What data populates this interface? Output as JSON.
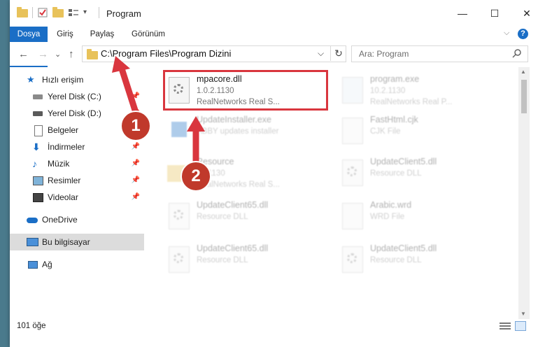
{
  "window": {
    "title": "Program",
    "controls": {
      "minimize": "—",
      "maximize": "☐",
      "close": "✕"
    }
  },
  "ribbon": {
    "tabs": [
      "Dosya",
      "Giriş",
      "Paylaş",
      "Görünüm"
    ],
    "expand_icon": "chevron-down-icon",
    "help_label": "?"
  },
  "navigation": {
    "back": "←",
    "forward": "→",
    "dropdown": "⌄",
    "up": "↑",
    "address": "C:\\Program Files\\Program Dizini",
    "refresh": "↻",
    "search_placeholder": "Ara: Program"
  },
  "sidebar": {
    "items": [
      {
        "label": "Hızlı erişim",
        "icon": "star-icon",
        "pinned": false
      },
      {
        "label": "Yerel Disk (C:)",
        "icon": "drive-icon",
        "pinned": true
      },
      {
        "label": "Yerel Disk (D:)",
        "icon": "drive-icon",
        "pinned": true
      },
      {
        "label": "Belgeler",
        "icon": "documents-icon",
        "pinned": true
      },
      {
        "label": "İndirmeler",
        "icon": "download-icon",
        "pinned": true
      },
      {
        "label": "Müzik",
        "icon": "music-icon",
        "pinned": true
      },
      {
        "label": "Resimler",
        "icon": "pictures-icon",
        "pinned": true
      },
      {
        "label": "Videolar",
        "icon": "videos-icon",
        "pinned": true
      },
      {
        "label": "OneDrive",
        "icon": "cloud-icon",
        "pinned": false
      },
      {
        "label": "Bu bilgisayar",
        "icon": "computer-icon",
        "pinned": false,
        "selected": true
      },
      {
        "label": "Ağ",
        "icon": "network-icon",
        "pinned": false
      }
    ]
  },
  "files": [
    {
      "name": "mpacore.dll",
      "line1": "1.0.2.1130",
      "line2": "RealNetworks Real S...",
      "icon": "dll-gear-icon",
      "highlighted": true
    },
    {
      "name": "program.exe",
      "line1": "10.2.1130",
      "line2": "RealNetworks Real P...",
      "icon": "exe-icon"
    },
    {
      "name": "",
      "line1": "ABBY updates installer",
      "line2": "",
      "icon": "installer-icon",
      "prefix": "UpdateInstaller.exe"
    },
    {
      "name": "FastHtml.cjk",
      "line1": "CJK File",
      "line2": "",
      "icon": "document-icon"
    },
    {
      "name": "Resource",
      "line1": "10.1130",
      "line2": "RealNetworks Real S...",
      "icon": "folder-icon"
    },
    {
      "name": "UpdateClient5.dll",
      "line1": "Resource DLL",
      "line2": "",
      "icon": "dll-gear-icon"
    },
    {
      "name": "UpdateClient65.dll",
      "line1": "Resource DLL",
      "line2": "",
      "icon": "dll-gear-icon"
    },
    {
      "name": "Arabic.wrd",
      "line1": "WRD File",
      "line2": "",
      "icon": "document-icon"
    },
    {
      "name": "UpdateClient65.dll",
      "line1": "Resource DLL",
      "line2": "",
      "icon": "dll-gear-icon"
    },
    {
      "name": "UpdateClient5.dll",
      "line1": "Resource DLL",
      "line2": "",
      "icon": "dll-gear-icon"
    }
  ],
  "status": {
    "count": "101 öğe"
  },
  "callouts": [
    "1",
    "2"
  ],
  "colors": {
    "accent": "#1a6ec6",
    "highlight": "#d9363e",
    "callout": "#c0392b"
  }
}
